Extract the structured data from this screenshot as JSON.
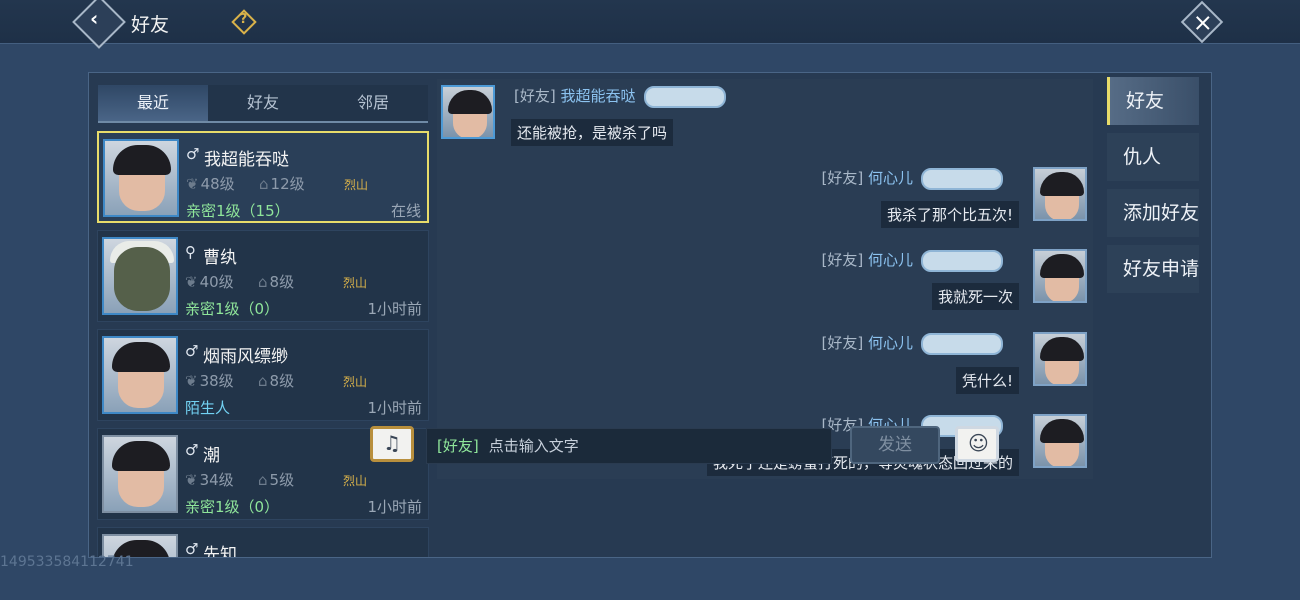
{
  "header": {
    "title": "好友",
    "back_icon": "back-arrow-icon",
    "help_label": "?",
    "close_icon": "close-icon"
  },
  "tabs": [
    {
      "label": "最近",
      "active": true
    },
    {
      "label": "好友",
      "active": false
    },
    {
      "label": "邻居",
      "active": false
    }
  ],
  "friends": [
    {
      "gender": "♂",
      "name": "我超能吞哒",
      "level": "48级",
      "home_level": "12级",
      "sect": "烈山",
      "intimacy": "亲密1级（15）",
      "status": "在线",
      "selected": true
    },
    {
      "gender": "⚲",
      "name": "曹纨",
      "level": "40级",
      "home_level": "8级",
      "sect": "烈山",
      "intimacy": "亲密1级（0）",
      "status": "1小时前"
    },
    {
      "gender": "♂",
      "name": "烟雨风缥缈",
      "level": "38级",
      "home_level": "8级",
      "sect": "烈山",
      "intimacy": "陌生人",
      "status": "1小时前"
    },
    {
      "gender": "♂",
      "name": "潮",
      "level": "34级",
      "home_level": "5级",
      "sect": "烈山",
      "intimacy": "亲密1级（0）",
      "status": "1小时前"
    },
    {
      "gender": "♂",
      "name": "先知"
    }
  ],
  "chat": {
    "messages": [
      {
        "side": "left",
        "channel": "[好友]",
        "name": "我超能吞哒",
        "text": "还能被抢，是被杀了吗"
      },
      {
        "side": "right",
        "channel": "[好友]",
        "name": "何心儿",
        "text": "我杀了那个比五次!"
      },
      {
        "side": "right",
        "channel": "[好友]",
        "name": "何心儿",
        "text": "我就死一次"
      },
      {
        "side": "right",
        "channel": "[好友]",
        "name": "何心儿",
        "text": "凭什么!"
      },
      {
        "side": "right",
        "channel": "[好友]",
        "name": "何心儿",
        "text": "我死了还是螃蟹打死的，等灵魂状态回过来的"
      }
    ],
    "input": {
      "channel": "[好友]",
      "placeholder": "点击输入文字"
    },
    "send_label": "发送"
  },
  "side_nav": [
    {
      "label": "好友",
      "active": true
    },
    {
      "label": "仇人"
    },
    {
      "label": "添加好友"
    },
    {
      "label": "好友申请"
    }
  ],
  "watermark": "149533584112741",
  "colors": {
    "accent": "#e8dc6a",
    "intimacy": "#8fe59a",
    "stranger": "#72d1f2",
    "sect": "#d9b24a"
  }
}
